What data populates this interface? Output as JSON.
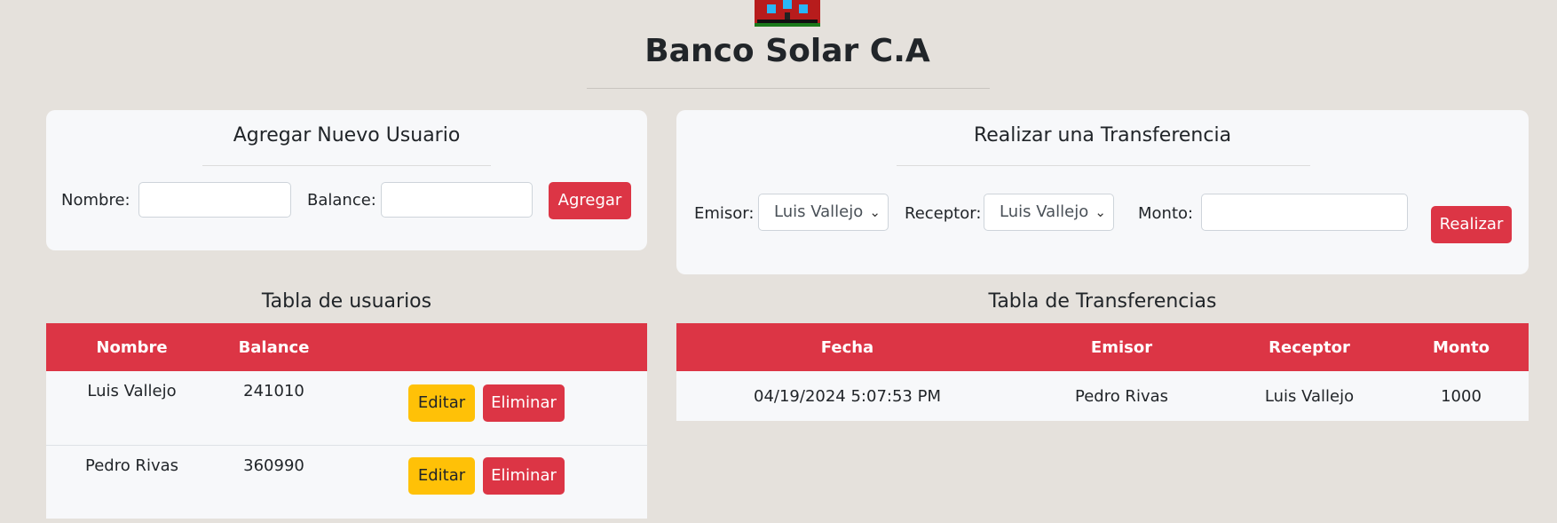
{
  "header": {
    "title": "Banco Solar C.A",
    "logo_icon": "bank-building-icon"
  },
  "add_user": {
    "title": "Agregar Nuevo Usuario",
    "name_label": "Nombre:",
    "name_value": "",
    "balance_label": "Balance:",
    "balance_value": "",
    "submit_label": "Agregar"
  },
  "transfer": {
    "title": "Realizar una Transferencia",
    "sender_label": "Emisor:",
    "sender_value": "Luis Vallejo",
    "receiver_label": "Receptor:",
    "receiver_value": "Luis Vallejo",
    "amount_label": "Monto:",
    "amount_value": "",
    "submit_label": "Realizar"
  },
  "users_table": {
    "title": "Tabla de usuarios",
    "columns": [
      "Nombre",
      "Balance",
      ""
    ],
    "rows": [
      {
        "name": "Luis Vallejo",
        "balance": "241010",
        "edit_label": "Editar",
        "delete_label": "Eliminar"
      },
      {
        "name": "Pedro Rivas",
        "balance": "360990",
        "edit_label": "Editar",
        "delete_label": "Eliminar"
      }
    ]
  },
  "transfers_table": {
    "title": "Tabla de Transferencias",
    "columns": [
      "Fecha",
      "Emisor",
      "Receptor",
      "Monto"
    ],
    "rows": [
      {
        "date": "04/19/2024 5:07:53 PM",
        "sender": "Pedro Rivas",
        "receiver": "Luis Vallejo",
        "amount": "1000"
      }
    ]
  },
  "colors": {
    "accent": "#dc3545",
    "warning": "#ffc107",
    "background": "#e5e1dc",
    "card": "#f7f8fa"
  }
}
